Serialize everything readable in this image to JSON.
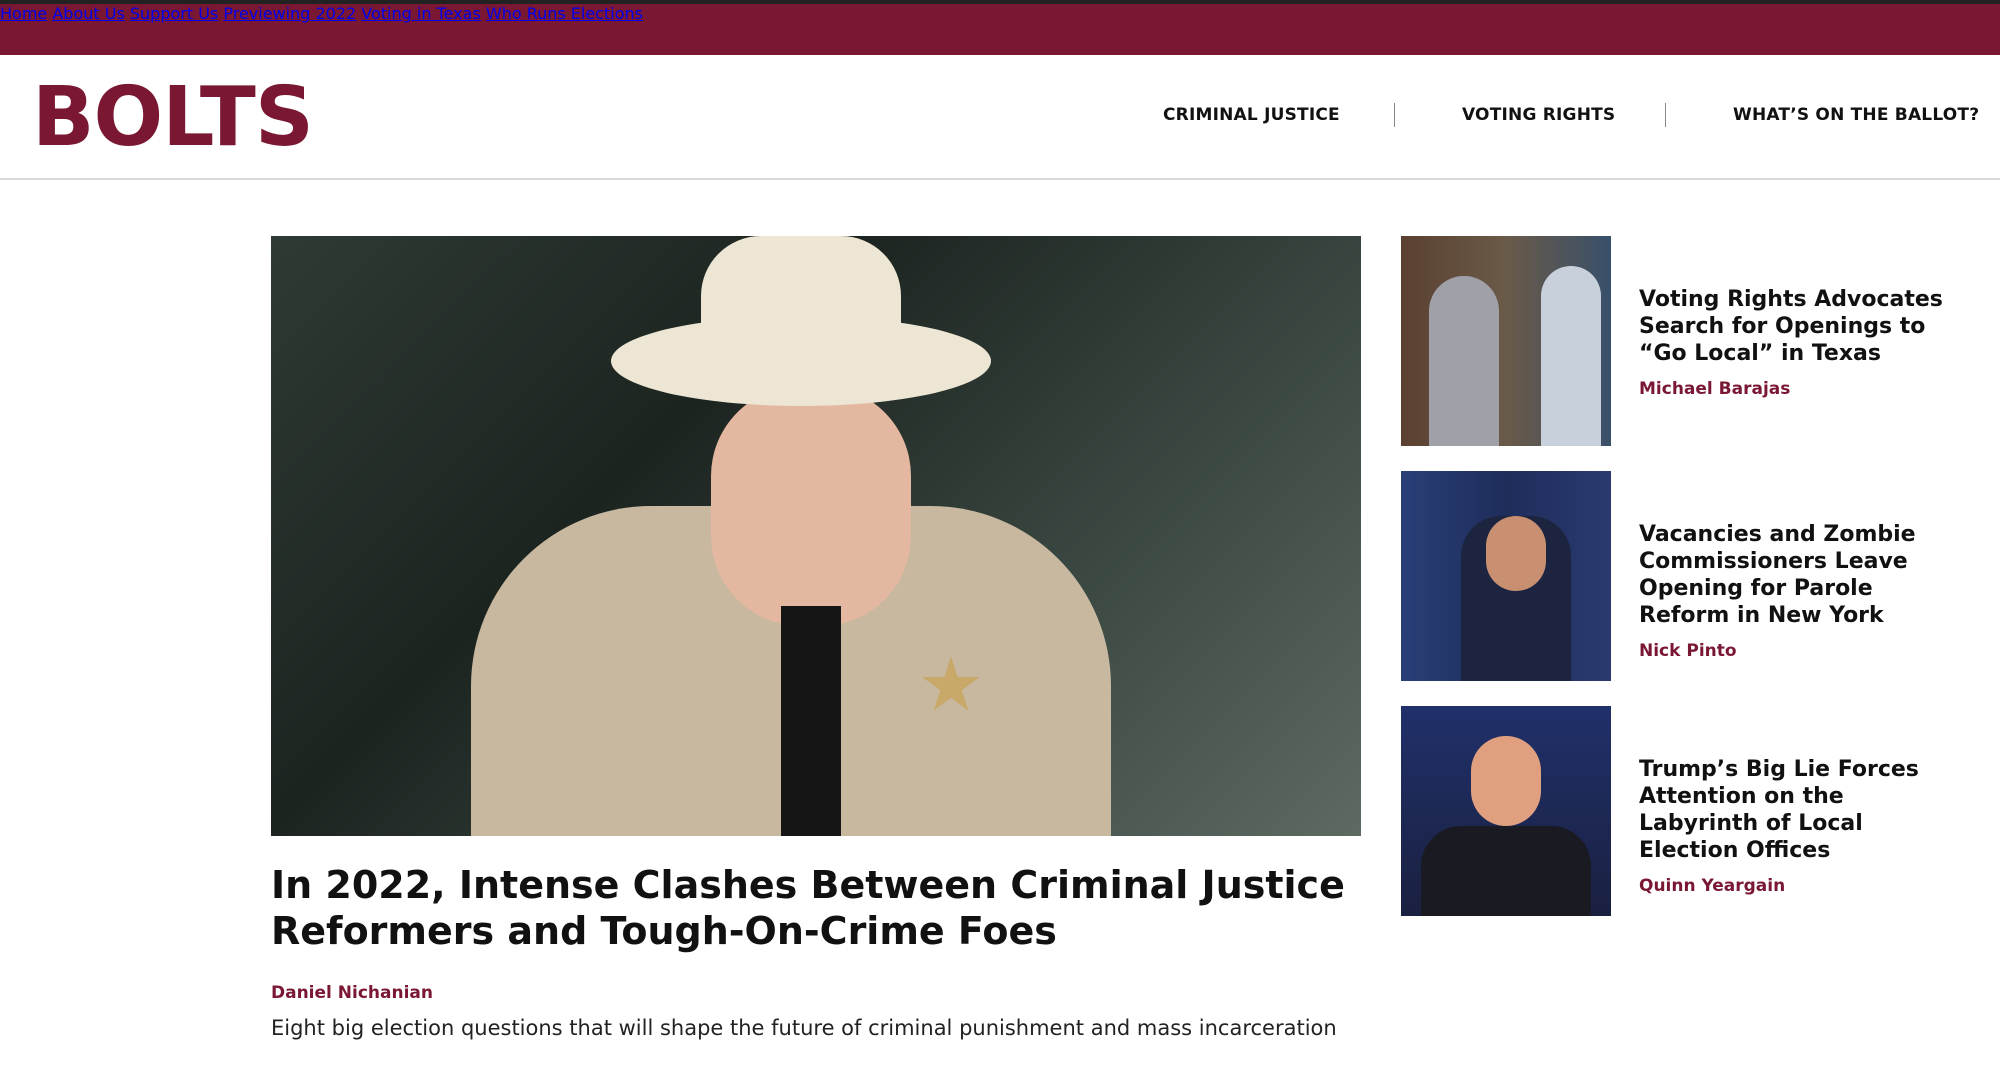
{
  "colors": {
    "brand": "#7a1834",
    "accent": "#d9a400",
    "text": "#111111"
  },
  "topnav": {
    "items": [
      {
        "label": "Home"
      },
      {
        "label": "About Us"
      },
      {
        "label": "Support Us"
      },
      {
        "label": "Previewing 2022"
      },
      {
        "label": "Voting in Texas"
      },
      {
        "label": "Who Runs Elections"
      }
    ]
  },
  "header": {
    "logo_text": "BOLTS",
    "sections": [
      {
        "label": "CRIMINAL JUSTICE"
      },
      {
        "label": "VOTING RIGHTS"
      },
      {
        "label": "WHAT’S ON THE BALLOT?"
      }
    ]
  },
  "hero": {
    "title": "In 2022, Intense Clashes Between Criminal Justice Reformers and Tough-On-Crime Foes",
    "author": "Daniel Nichanian",
    "dek": "Eight big election questions that will shape the future of criminal punishment and mass incarceration"
  },
  "sidebar": {
    "articles": [
      {
        "title": "Voting Rights Advocates Search for Openings to “Go Local” in Texas",
        "author": "Michael Barajas"
      },
      {
        "title": "Vacancies and Zombie Commissioners Leave Opening for Parole Reform in New York",
        "author": "Nick Pinto"
      },
      {
        "title": "Trump’s Big Lie Forces Attention on the Labyrinth of Local Election Offices",
        "author": "Quinn Yeargain"
      }
    ]
  }
}
